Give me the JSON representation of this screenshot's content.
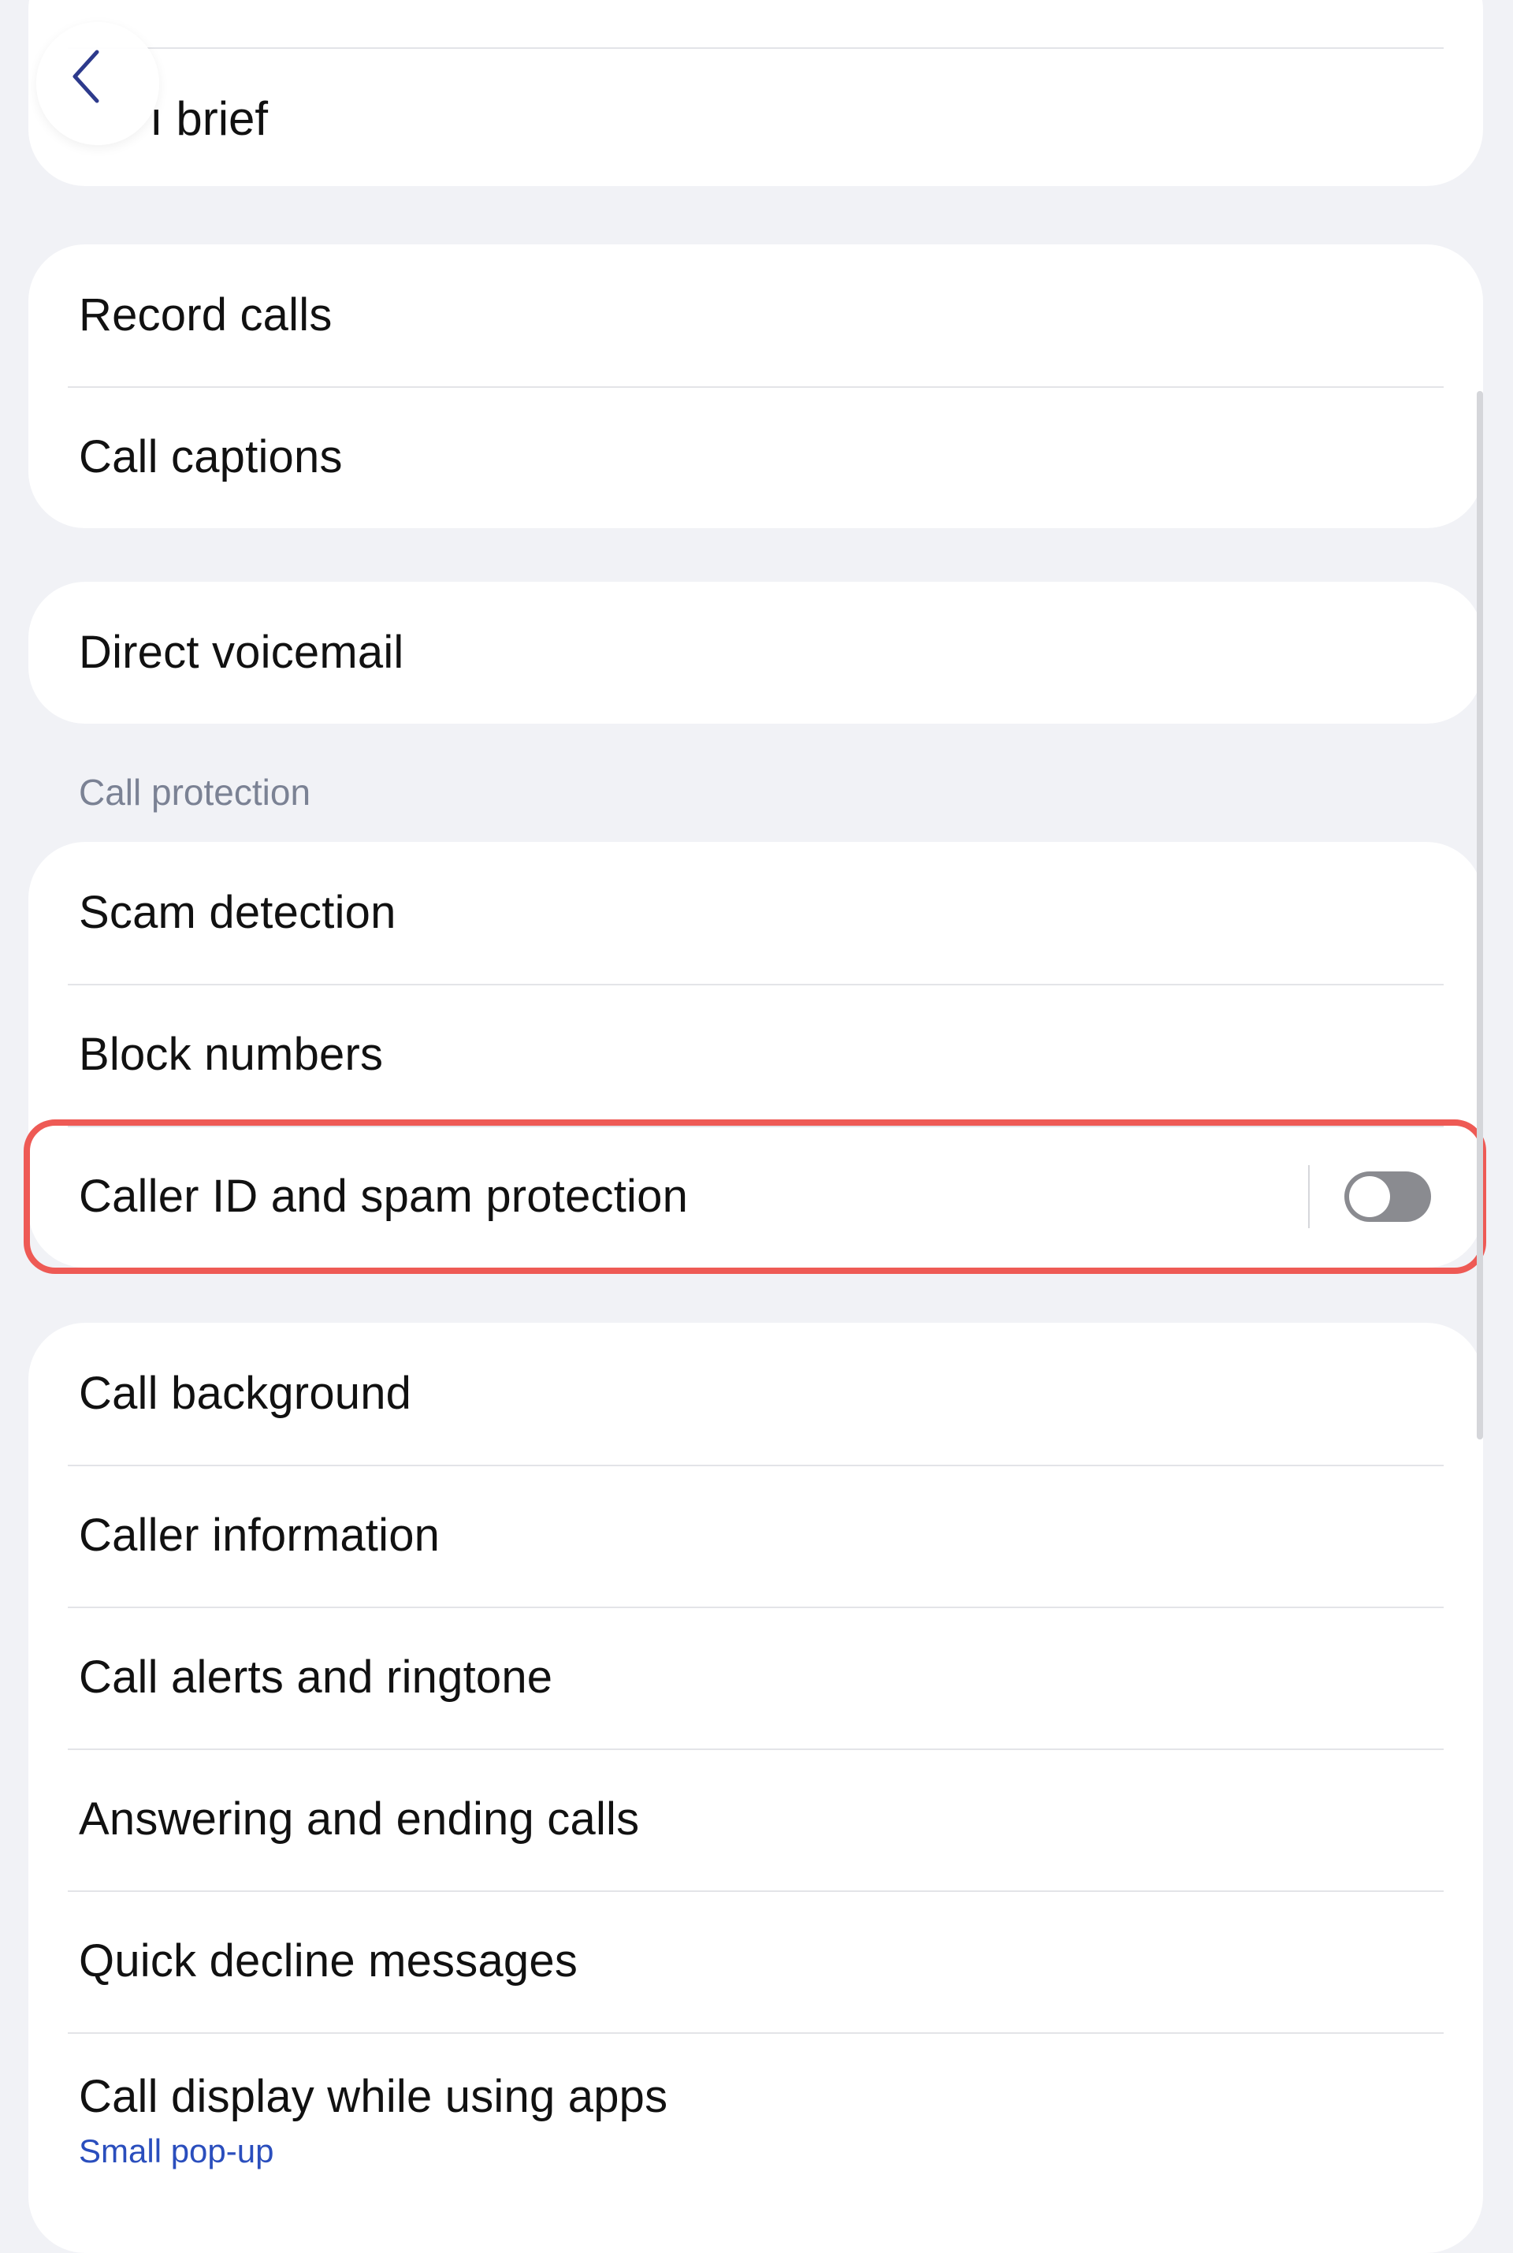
{
  "header": {
    "title_fragment": "ı brief",
    "back_icon": "chevron-left-icon"
  },
  "groups": {
    "recording": [
      "Record calls",
      "Call captions"
    ],
    "voicemail": [
      "Direct voicemail"
    ],
    "protection_header": "Call protection",
    "protection": [
      "Scam detection",
      "Block numbers",
      "Caller ID and spam protection"
    ],
    "other": [
      "Call background",
      "Caller information",
      "Call alerts and ringtone",
      "Answering and ending calls",
      "Quick decline messages",
      "Call display while using apps"
    ],
    "other_sub": "Small pop-up"
  },
  "toggle": {
    "caller_id_on": false
  },
  "colors": {
    "background": "#f1f2f6",
    "highlight": "#ee5a55",
    "link": "#2a4ebd",
    "back_icon": "#2d3a8c"
  }
}
